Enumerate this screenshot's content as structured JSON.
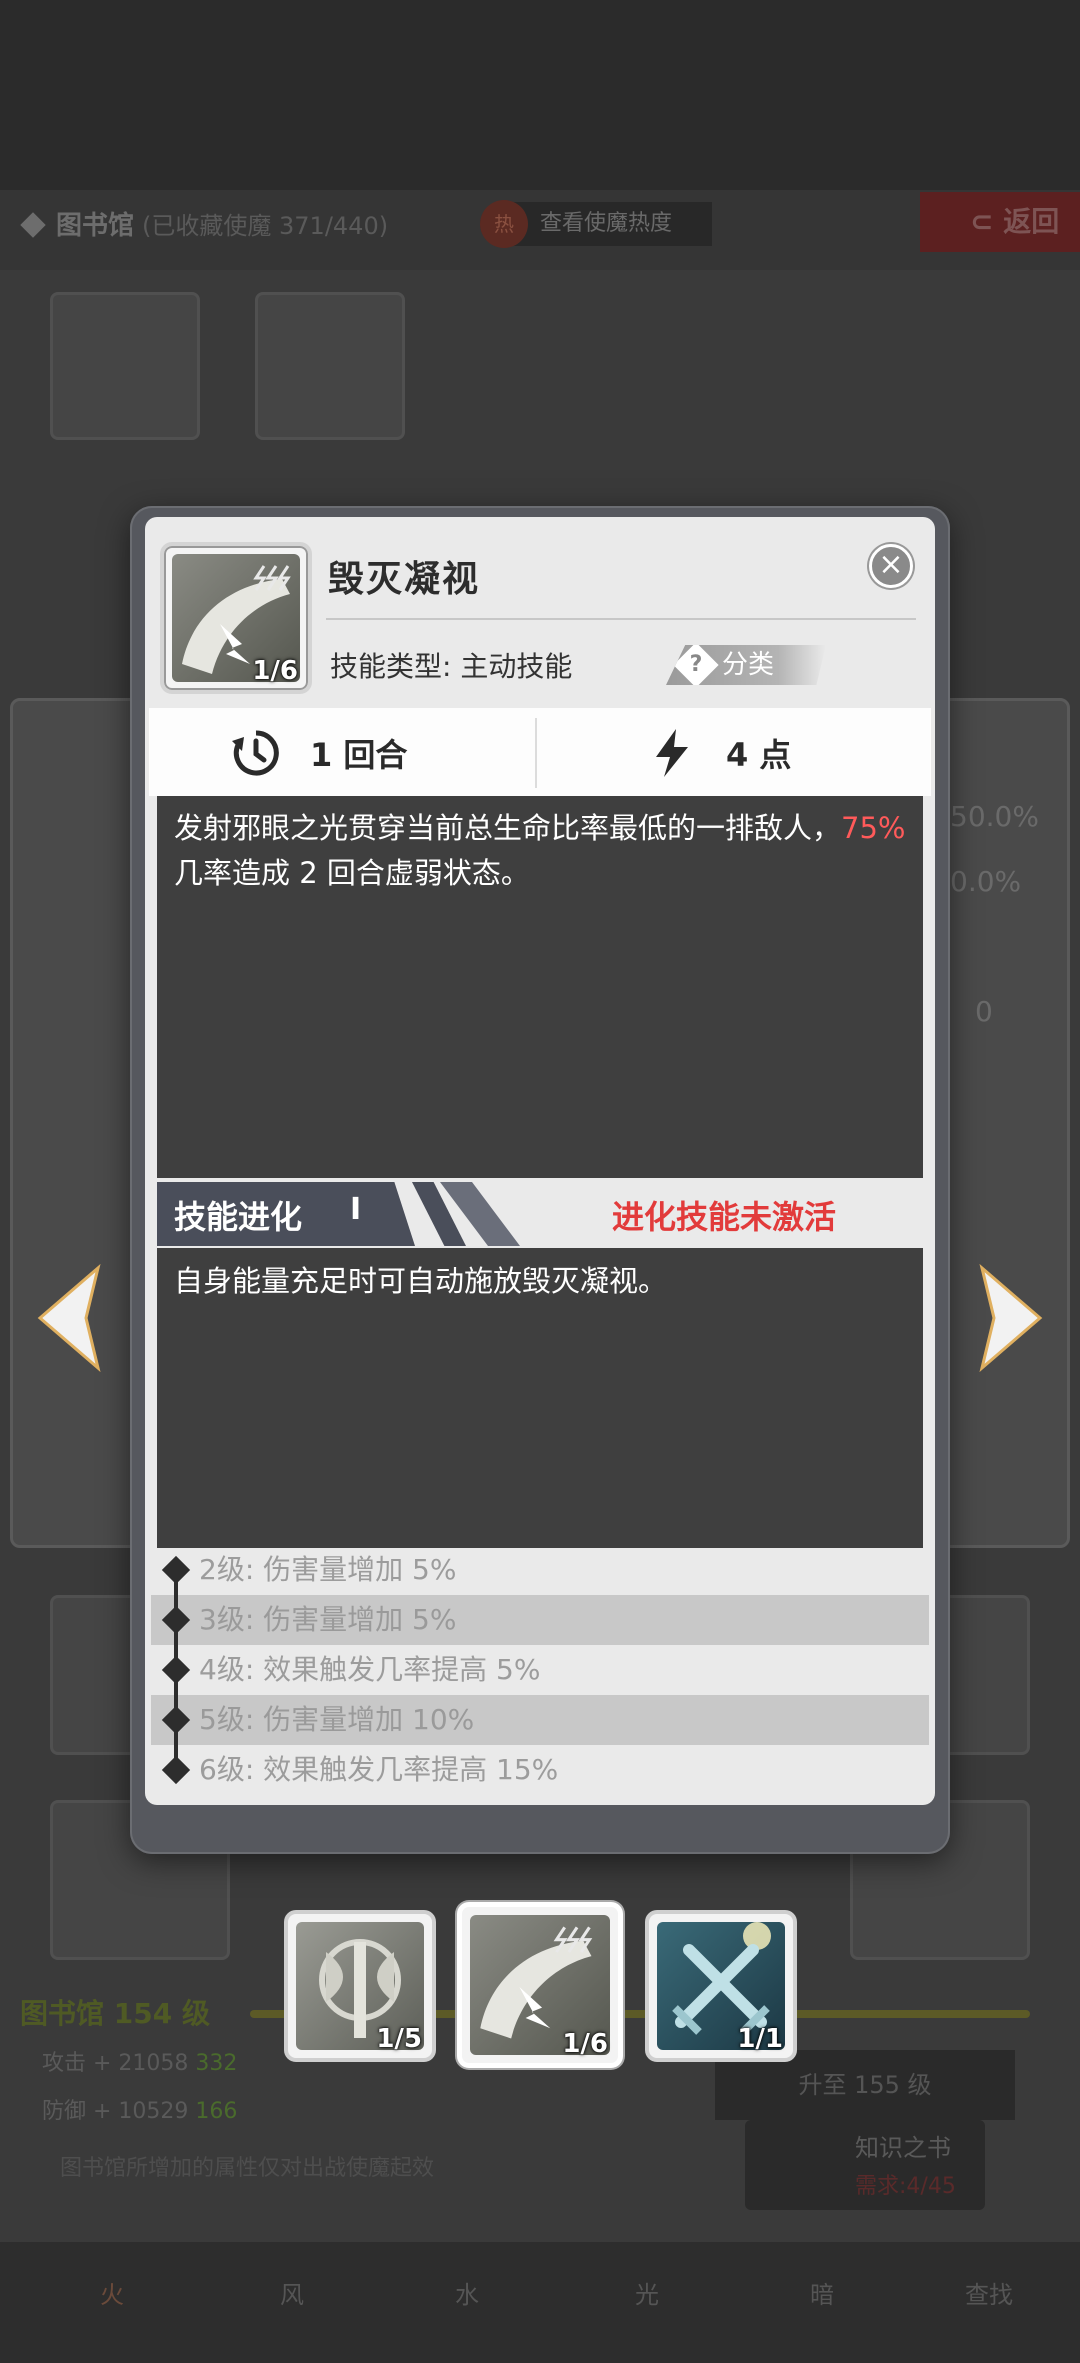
{
  "background": {
    "library_title": "图书馆",
    "collected": "(已收藏使魔 371/440)",
    "heat_badge": "热",
    "view_heat": "查看使魔热度",
    "back": "返回",
    "library_level": "图书馆 154 级",
    "attack": "攻击 + 21058",
    "attack_inc": "332",
    "defense": "防御 + 10529",
    "defense_inc": "166",
    "upgrade_to": "升至 155 级",
    "knowledge_book": "知识之书",
    "requirement": "需求:4/45",
    "note": "图书馆所增加的属性仅对出战使魔起效",
    "tabs": [
      "火",
      "风",
      "水",
      "光",
      "暗",
      "查找"
    ],
    "side_values": [
      "50.0%",
      "0.0%",
      "0"
    ]
  },
  "dialog": {
    "skill_name": "毁灭凝视",
    "skill_count": "1/6",
    "skill_type": "技能类型: 主动技能",
    "category": "分类",
    "category_q": "?",
    "close": "×",
    "cooldown": "1 回合",
    "cost": "4 点",
    "description_pre": "发射邪眼之光贯穿当前总生命比率最低的一排敌人，",
    "description_highlight": "75%",
    "description_post": " 几率造成 2 回合虚弱状态。",
    "evolution_label": "技能进化",
    "evolution_roman": "I",
    "evolution_status": "进化技能未激活",
    "evolution_desc": "自身能量充足时可自动施放毁灭凝视。",
    "levels": [
      "2级:  伤害量增加 5%",
      "3级:  伤害量增加 5%",
      "4级:  效果触发几率提高 5%",
      "5级:  伤害量增加 10%",
      "6级:  效果触发几率提高 15%"
    ]
  },
  "skill_slots": [
    {
      "count": "1/5"
    },
    {
      "count": "1/6"
    },
    {
      "count": "1/1"
    }
  ]
}
